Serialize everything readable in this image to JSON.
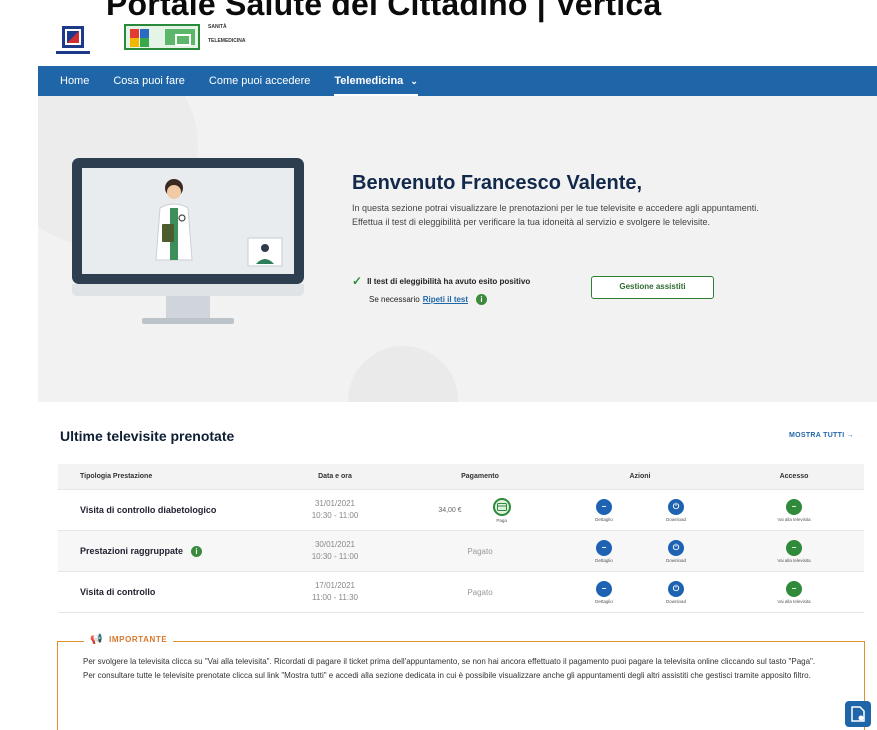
{
  "page_title": "Portale Salute del Cittadino | Vertica",
  "header": {
    "logo_text_top": "SANITÀ",
    "logo_text_bottom": "TELEMEDICINA"
  },
  "nav": {
    "items": [
      "Home",
      "Cosa puoi fare",
      "Come puoi accedere"
    ],
    "active": "Telemedicina",
    "active_chevron": "⌄"
  },
  "hero": {
    "title": "Benvenuto Francesco Valente,",
    "text": "In questa sezione potrai visualizzare le prenotazioni per le tue televisite e accedere agli appuntamenti. Effettua il test di eleggibilità per verificare la tua idoneità al servizio e svolgere le televisite.",
    "eligibility_result": "Il test di eleggibilità ha avuto esito positivo",
    "repeat_prefix": "Se necessario",
    "repeat_link": "Ripeti il test",
    "manage_button": "Gestione assistiti"
  },
  "section": {
    "title": "Ultime televisite prenotate",
    "show_all": "MOSTRA TUTTI  →"
  },
  "table": {
    "headers": [
      "Tipologia Prestazione",
      "Data e ora",
      "Pagamento",
      "Azioni",
      "Accesso"
    ],
    "action_labels": [
      "Dettaglio",
      "Download"
    ],
    "access_label": "Vai alla televisita",
    "pay_label": "Paga",
    "rows": [
      {
        "name": "Visita di controllo diabetologico",
        "date": "31/01/2021",
        "time": "10:30 - 11:00",
        "price": "34,00 €",
        "payment": "",
        "has_info": false
      },
      {
        "name": "Prestazioni raggruppate",
        "date": "30/01/2021",
        "time": "10:30 - 11:00",
        "price": "",
        "payment": "Pagato",
        "has_info": true
      },
      {
        "name": "Visita di controllo",
        "date": "17/01/2021",
        "time": "11:00 - 11:30",
        "price": "",
        "payment": "Pagato",
        "has_info": false
      }
    ]
  },
  "notice": {
    "heading": "IMPORTANTE",
    "line1": "Per svolgere la televisita clicca su \"Vai alla televisita\". Ricordati di pagare il ticket prima dell'appuntamento, se non hai ancora effettuato il pagamento puoi pagare la televisita online cliccando sul tasto \"Paga\".",
    "line2": "Per consultare tutte le televisite prenotate clicca sul link \"Mostra tutti\" e accedi alla sezione dedicata in cui è possibile visualizzare anche gli appuntamenti degli altri assistiti che gestisci tramite apposito filtro."
  },
  "colors": {
    "primary": "#1f66a8",
    "success": "#2f8a3a",
    "warning": "#e1902d"
  }
}
